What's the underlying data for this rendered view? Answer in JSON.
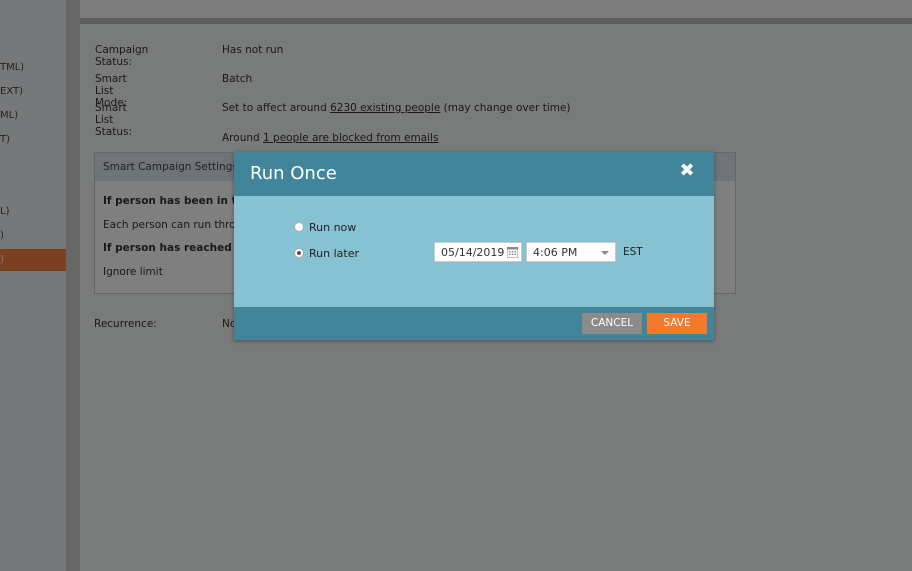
{
  "sidebar": {
    "items": [
      "TML)",
      "EXT)",
      "ML)",
      "T)",
      "L)",
      ")",
      ")"
    ]
  },
  "info": {
    "campaign_status_label": "Campaign Status:",
    "campaign_status_value": "Has not run",
    "smart_list_mode_label": "Smart List Mode:",
    "smart_list_mode_value": "Batch",
    "smart_list_status_label": "Smart List Status:",
    "smart_list_status_prefix": "Set to affect around",
    "smart_list_status_link": "6230 existing people",
    "smart_list_status_suffix": "(may change over time)",
    "blocked_prefix": "Around",
    "blocked_link": "1 people are blocked from emails"
  },
  "settings": {
    "header": "Smart Campaign Settings",
    "line1": "If person has been in th",
    "line2": "Each person can run thro",
    "line3": "If person has reached th",
    "line4": "Ignore limit"
  },
  "recurrence": {
    "label": "Recurrence:",
    "value": "No"
  },
  "modal": {
    "title": "Run Once",
    "close_symbol": "✖",
    "run_now_label": "Run now",
    "run_later_label": "Run later",
    "date_value": "05/14/2019",
    "time_value": "4:06 PM",
    "timezone": "EST",
    "cancel_label": "CANCEL",
    "save_label": "SAVE"
  },
  "colors": {
    "header": "#42859a",
    "body": "#87c2d2",
    "save": "#f4792d",
    "cancel": "#8b8b8b",
    "active_nav": "#f58341"
  }
}
